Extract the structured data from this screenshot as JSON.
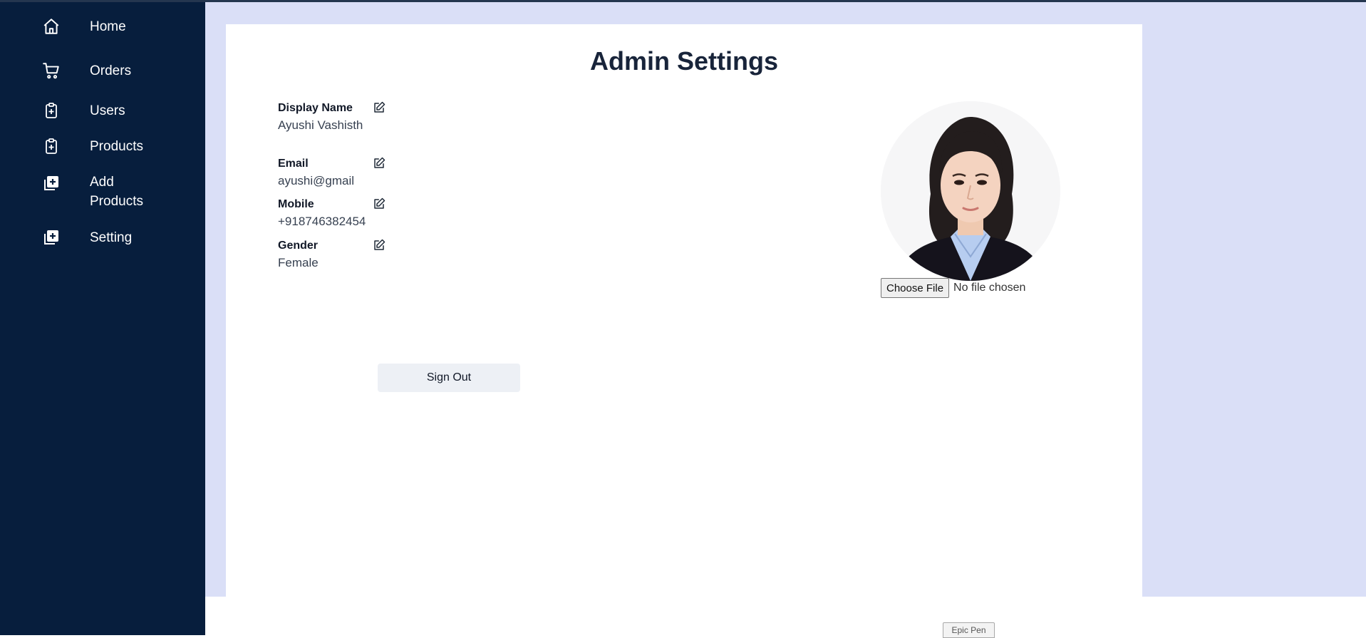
{
  "sidebar": {
    "items": [
      {
        "label": "Home",
        "icon": "home-icon"
      },
      {
        "label": "Orders",
        "icon": "cart-icon"
      },
      {
        "label": "Users",
        "icon": "clipboard-plus-icon"
      },
      {
        "label": "Products",
        "icon": "clipboard-plus-icon"
      },
      {
        "label_line1": "Add",
        "label_line2": "Products",
        "icon": "add-box-icon"
      },
      {
        "label": "Setting",
        "icon": "add-box-icon"
      }
    ]
  },
  "page": {
    "title": "Admin Settings"
  },
  "profile": {
    "display_name_label": "Display Name",
    "display_name_value": "Ayushi Vashisth",
    "email_label": "Email",
    "email_value": "ayushi@gmail",
    "mobile_label": "Mobile",
    "mobile_value": "+918746382454",
    "gender_label": "Gender",
    "gender_value": "Female"
  },
  "upload": {
    "button_label": "Choose File",
    "status": "No file chosen"
  },
  "actions": {
    "signout_label": "Sign Out"
  },
  "overlay": {
    "epic_pen_label": "Epic Pen"
  },
  "colors": {
    "sidebar": "#071e3d",
    "background": "#dadff7",
    "card": "#ffffff",
    "title": "#18243a",
    "signout_bg": "#edf0f5"
  }
}
